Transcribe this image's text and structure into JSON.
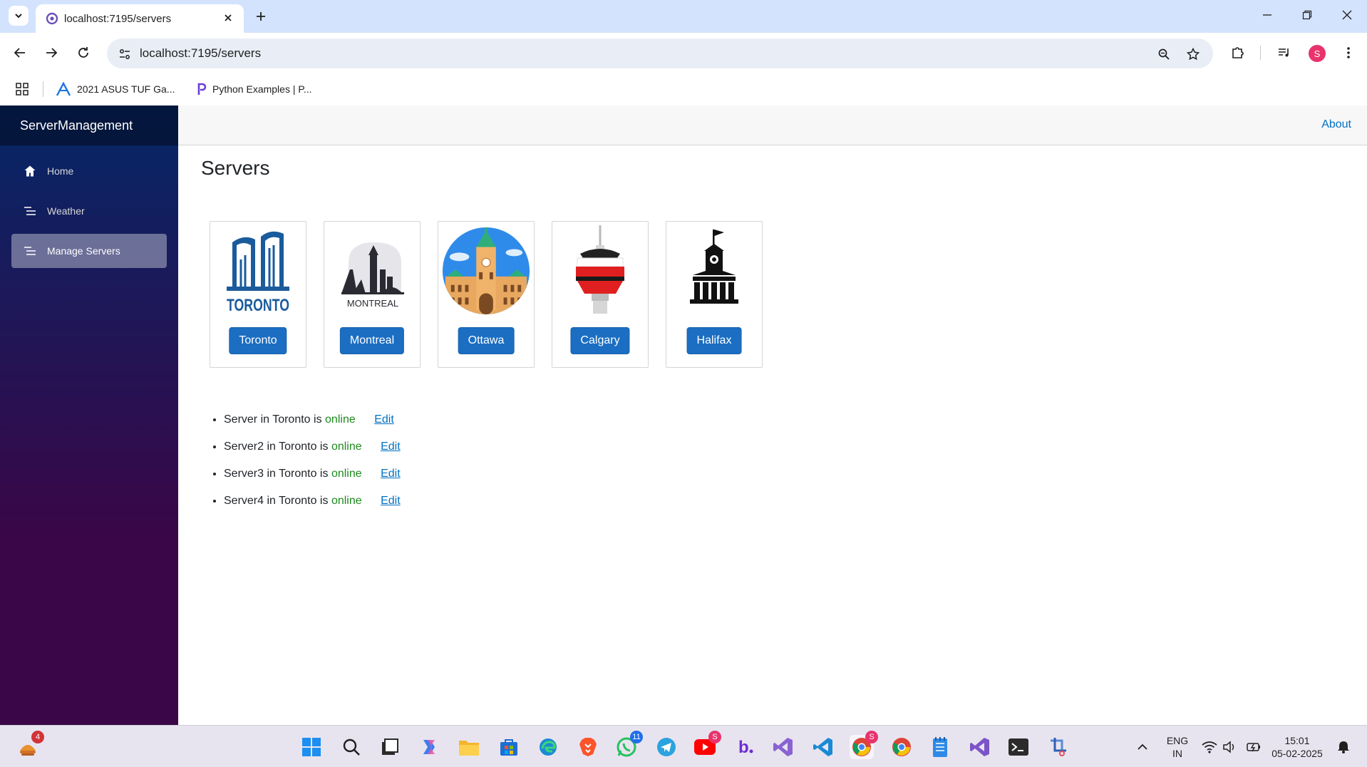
{
  "browser": {
    "tab_title": "localhost:7195/servers",
    "url": "localhost:7195/servers",
    "bookmarks": [
      {
        "label": "2021 ASUS TUF Ga...",
        "icon": "asus-icon"
      },
      {
        "label": "Python Examples | P...",
        "icon": "python-examples-icon"
      }
    ],
    "profile_initial": "S"
  },
  "app": {
    "brand": "ServerManagement",
    "nav": [
      {
        "label": "Home",
        "icon": "house-icon",
        "active": false
      },
      {
        "label": "Weather",
        "icon": "list-icon",
        "active": false
      },
      {
        "label": "Manage Servers",
        "icon": "list-icon",
        "active": true
      }
    ],
    "about_label": "About",
    "page_title": "Servers",
    "cities": [
      {
        "name": "Toronto",
        "image_caption": "TORONTO"
      },
      {
        "name": "Montreal",
        "image_caption": "MONTREAL"
      },
      {
        "name": "Ottawa",
        "image_caption": ""
      },
      {
        "name": "Calgary",
        "image_caption": ""
      },
      {
        "name": "Halifax",
        "image_caption": ""
      }
    ],
    "servers": [
      {
        "name": "Server",
        "city": "Toronto",
        "status": "online",
        "action": "Edit"
      },
      {
        "name": "Server2",
        "city": "Toronto",
        "status": "online",
        "action": "Edit"
      },
      {
        "name": "Server3",
        "city": "Toronto",
        "status": "online",
        "action": "Edit"
      },
      {
        "name": "Server4",
        "city": "Toronto",
        "status": "online",
        "action": "Edit"
      }
    ],
    "text": {
      "in": "in",
      "is": "is"
    },
    "colors": {
      "accent": "#1b6ec2",
      "online": "#1e8a1e",
      "link": "#0071c1",
      "sidebar_top": "#052767",
      "sidebar_bottom": "#3a0647"
    }
  },
  "taskbar": {
    "widget_badge": "4",
    "whatsapp_badge": "11",
    "youtube_badge": "S",
    "chrome_badge": "S",
    "language_line1": "ENG",
    "language_line2": "IN",
    "time": "15:01",
    "date": "05-02-2025"
  }
}
